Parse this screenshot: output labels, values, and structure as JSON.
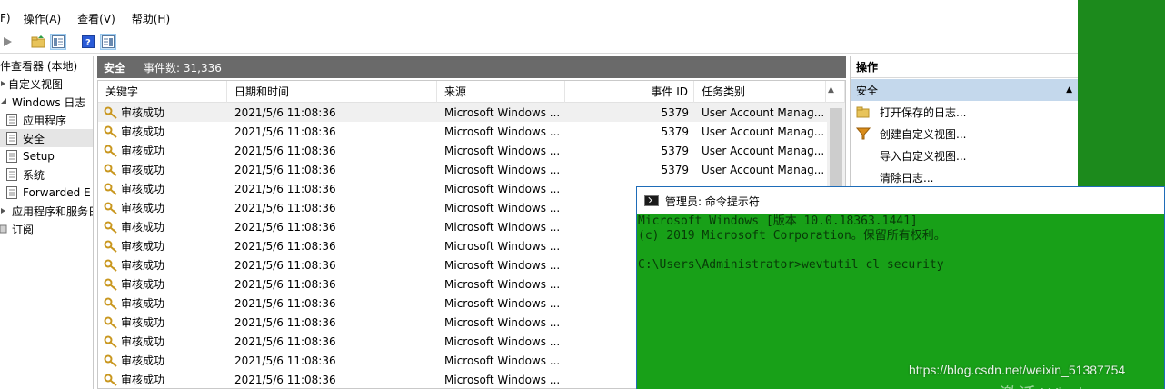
{
  "menubar": {
    "items": [
      "F)",
      "操作(A)",
      "查看(V)",
      "帮助(H)"
    ]
  },
  "tree": {
    "items": [
      {
        "label": "件查看器 (本地)",
        "icon": "event-viewer-icon"
      },
      {
        "label": "自定义视图",
        "icon": "folder-icon"
      },
      {
        "label": "Windows 日志",
        "icon": "folder-icon"
      },
      {
        "label": "应用程序",
        "icon": "log-icon"
      },
      {
        "label": "安全",
        "icon": "log-icon"
      },
      {
        "label": "Setup",
        "icon": "log-icon"
      },
      {
        "label": "系统",
        "icon": "log-icon"
      },
      {
        "label": "Forwarded E",
        "icon": "log-icon"
      },
      {
        "label": "应用程序和服务日",
        "icon": "folder-icon"
      },
      {
        "label": "订阅",
        "icon": "subscription-icon"
      }
    ]
  },
  "center": {
    "title": "安全",
    "event_count": "事件数: 31,336",
    "columns": [
      "关键字",
      "日期和时间",
      "来源",
      "事件 ID",
      "任务类别"
    ],
    "rows": [
      [
        "审核成功",
        "2021/5/6 11:08:36",
        "Microsoft Windows ...",
        "5379",
        "User Account Manag..."
      ],
      [
        "审核成功",
        "2021/5/6 11:08:36",
        "Microsoft Windows ...",
        "5379",
        "User Account Manag..."
      ],
      [
        "审核成功",
        "2021/5/6 11:08:36",
        "Microsoft Windows ...",
        "5379",
        "User Account Manag..."
      ],
      [
        "审核成功",
        "2021/5/6 11:08:36",
        "Microsoft Windows ...",
        "5379",
        "User Account Manag..."
      ],
      [
        "审核成功",
        "2021/5/6 11:08:36",
        "Microsoft Windows ...",
        "",
        ""
      ],
      [
        "审核成功",
        "2021/5/6 11:08:36",
        "Microsoft Windows ...",
        "",
        ""
      ],
      [
        "审核成功",
        "2021/5/6 11:08:36",
        "Microsoft Windows ...",
        "",
        ""
      ],
      [
        "审核成功",
        "2021/5/6 11:08:36",
        "Microsoft Windows ...",
        "",
        ""
      ],
      [
        "审核成功",
        "2021/5/6 11:08:36",
        "Microsoft Windows ...",
        "",
        ""
      ],
      [
        "审核成功",
        "2021/5/6 11:08:36",
        "Microsoft Windows ...",
        "",
        ""
      ],
      [
        "审核成功",
        "2021/5/6 11:08:36",
        "Microsoft Windows ...",
        "",
        ""
      ],
      [
        "审核成功",
        "2021/5/6 11:08:36",
        "Microsoft Windows ...",
        "",
        ""
      ],
      [
        "审核成功",
        "2021/5/6 11:08:36",
        "Microsoft Windows ...",
        "",
        ""
      ],
      [
        "审核成功",
        "2021/5/6 11:08:36",
        "Microsoft Windows ...",
        "",
        ""
      ],
      [
        "审核成功",
        "2021/5/6 11:08:36",
        "Microsoft Windows ...",
        "",
        ""
      ]
    ]
  },
  "actions": {
    "title": "操作",
    "section": "安全",
    "items": [
      {
        "label": "打开保存的日志...",
        "icon": "open-folder-icon"
      },
      {
        "label": "创建自定义视图...",
        "icon": "filter-icon"
      },
      {
        "label": "导入自定义视图...",
        "icon": "import-icon"
      },
      {
        "label": "清除日志...",
        "icon": "clear-log-icon"
      }
    ]
  },
  "cmd": {
    "title": "管理员: 命令提示符",
    "lines": [
      "Microsoft Windows [版本 10.0.18363.1441]",
      "(c) 2019 Microsoft Corporation。保留所有权利。",
      "",
      "C:\\Users\\Administrator>wevtutil cl security"
    ]
  },
  "overlay": {
    "watermark": "https://blog.csdn.net/weixin_51387754",
    "activate": "激活 Windows"
  },
  "colors": {
    "desktop": "#1c8a1c",
    "console_bg": "#18a018",
    "header_bg": "#6a6a6a",
    "section_bg": "#c4d8ec"
  }
}
